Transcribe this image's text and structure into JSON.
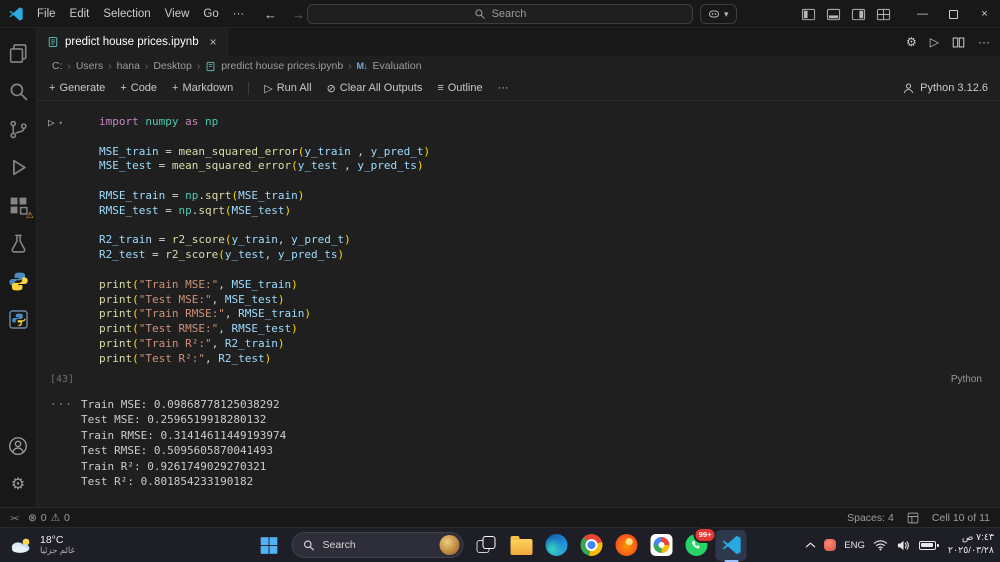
{
  "colors": {
    "accent": "#0078d4",
    "editor_bg": "#1f1f1f",
    "chrome_bg": "#181818",
    "whatsapp_green": "#25d366",
    "warning_orange": "#f0a732",
    "vscode_blue": "#2aa9e0"
  },
  "icons": {
    "plus": "+",
    "run": "▷",
    "clear": "⊘",
    "outline": "≡",
    "more": "···",
    "close": "×",
    "back": "←",
    "forward": "→",
    "chevron_down": "▾",
    "minimize": "—",
    "gear": "⚙",
    "error": "⊗",
    "warning": "⚠",
    "remote": "><",
    "output_ellipsis": "···"
  },
  "titlebar": {
    "menus": [
      "File",
      "Edit",
      "Selection",
      "View",
      "Go"
    ],
    "search_placeholder": "Search"
  },
  "tab": {
    "label": "predict house prices.ipynb"
  },
  "breadcrumb": {
    "drive": "C:",
    "users": "Users",
    "user": "hana",
    "desktop": "Desktop",
    "file": "predict house prices.ipynb",
    "section": "Evaluation",
    "sep": "›",
    "md_icon": "M↓"
  },
  "nb_toolbar": {
    "generate": "Generate",
    "code": "Code",
    "markdown": "Markdown",
    "run_all": "Run All",
    "clear_all": "Clear All Outputs",
    "outline": "Outline",
    "kernel": "Python 3.12.6"
  },
  "notebook": {
    "exec_count": "[43]",
    "language": "Python",
    "code_lines": [
      [
        {
          "t": "import ",
          "c": "kw"
        },
        {
          "t": "numpy ",
          "c": "mod"
        },
        {
          "t": "as ",
          "c": "kw"
        },
        {
          "t": "np",
          "c": "mod"
        }
      ],
      [],
      [
        {
          "t": "MSE_train ",
          "c": "var"
        },
        {
          "t": "= ",
          "c": "pl"
        },
        {
          "t": "mean_squared_error",
          "c": "fn"
        },
        {
          "t": "(",
          "c": "br"
        },
        {
          "t": "y_train",
          "c": "var"
        },
        {
          "t": " , ",
          "c": "pl"
        },
        {
          "t": "y_pred_t",
          "c": "var"
        },
        {
          "t": ")",
          "c": "br"
        }
      ],
      [
        {
          "t": "MSE_test ",
          "c": "var"
        },
        {
          "t": "= ",
          "c": "pl"
        },
        {
          "t": "mean_squared_error",
          "c": "fn"
        },
        {
          "t": "(",
          "c": "br"
        },
        {
          "t": "y_test",
          "c": "var"
        },
        {
          "t": " , ",
          "c": "pl"
        },
        {
          "t": "y_pred_ts",
          "c": "var"
        },
        {
          "t": ")",
          "c": "br"
        }
      ],
      [],
      [
        {
          "t": "RMSE_train ",
          "c": "var"
        },
        {
          "t": "= ",
          "c": "pl"
        },
        {
          "t": "np",
          "c": "mod"
        },
        {
          "t": ".",
          "c": "pl"
        },
        {
          "t": "sqrt",
          "c": "fn"
        },
        {
          "t": "(",
          "c": "br"
        },
        {
          "t": "MSE_train",
          "c": "var"
        },
        {
          "t": ")",
          "c": "br"
        }
      ],
      [
        {
          "t": "RMSE_test ",
          "c": "var"
        },
        {
          "t": "= ",
          "c": "pl"
        },
        {
          "t": "np",
          "c": "mod"
        },
        {
          "t": ".",
          "c": "pl"
        },
        {
          "t": "sqrt",
          "c": "fn"
        },
        {
          "t": "(",
          "c": "br"
        },
        {
          "t": "MSE_test",
          "c": "var"
        },
        {
          "t": ")",
          "c": "br"
        }
      ],
      [],
      [
        {
          "t": "R2_train ",
          "c": "var"
        },
        {
          "t": "= ",
          "c": "pl"
        },
        {
          "t": "r2_score",
          "c": "fn"
        },
        {
          "t": "(",
          "c": "br"
        },
        {
          "t": "y_train",
          "c": "var"
        },
        {
          "t": ", ",
          "c": "pl"
        },
        {
          "t": "y_pred_t",
          "c": "var"
        },
        {
          "t": ")",
          "c": "br"
        }
      ],
      [
        {
          "t": "R2_test ",
          "c": "var"
        },
        {
          "t": "= ",
          "c": "pl"
        },
        {
          "t": "r2_score",
          "c": "fn"
        },
        {
          "t": "(",
          "c": "br"
        },
        {
          "t": "y_test",
          "c": "var"
        },
        {
          "t": ", ",
          "c": "pl"
        },
        {
          "t": "y_pred_ts",
          "c": "var"
        },
        {
          "t": ")",
          "c": "br"
        }
      ],
      [],
      [
        {
          "t": "print",
          "c": "fn"
        },
        {
          "t": "(",
          "c": "br"
        },
        {
          "t": "\"Train MSE:\"",
          "c": "str"
        },
        {
          "t": ", ",
          "c": "pl"
        },
        {
          "t": "MSE_train",
          "c": "var"
        },
        {
          "t": ")",
          "c": "br"
        }
      ],
      [
        {
          "t": "print",
          "c": "fn"
        },
        {
          "t": "(",
          "c": "br"
        },
        {
          "t": "\"Test MSE:\"",
          "c": "str"
        },
        {
          "t": ", ",
          "c": "pl"
        },
        {
          "t": "MSE_test",
          "c": "var"
        },
        {
          "t": ")",
          "c": "br"
        }
      ],
      [
        {
          "t": "print",
          "c": "fn"
        },
        {
          "t": "(",
          "c": "br"
        },
        {
          "t": "\"Train RMSE:\"",
          "c": "str"
        },
        {
          "t": ", ",
          "c": "pl"
        },
        {
          "t": "RMSE_train",
          "c": "var"
        },
        {
          "t": ")",
          "c": "br"
        }
      ],
      [
        {
          "t": "print",
          "c": "fn"
        },
        {
          "t": "(",
          "c": "br"
        },
        {
          "t": "\"Test RMSE:\"",
          "c": "str"
        },
        {
          "t": ", ",
          "c": "pl"
        },
        {
          "t": "RMSE_test",
          "c": "var"
        },
        {
          "t": ")",
          "c": "br"
        }
      ],
      [
        {
          "t": "print",
          "c": "fn"
        },
        {
          "t": "(",
          "c": "br"
        },
        {
          "t": "\"Train R²:\"",
          "c": "str"
        },
        {
          "t": ", ",
          "c": "pl"
        },
        {
          "t": "R2_train",
          "c": "var"
        },
        {
          "t": ")",
          "c": "br"
        }
      ],
      [
        {
          "t": "print",
          "c": "fn"
        },
        {
          "t": "(",
          "c": "br"
        },
        {
          "t": "\"Test R²:\"",
          "c": "str"
        },
        {
          "t": ", ",
          "c": "pl"
        },
        {
          "t": "R2_test",
          "c": "var"
        },
        {
          "t": ")",
          "c": "br"
        }
      ]
    ],
    "output_lines": [
      "Train MSE: 0.09868778125038292",
      "Test MSE: 0.2596519918280132",
      "Train RMSE: 0.31414611449193974",
      "Test RMSE: 0.5095605870041493",
      "Train R²: 0.9261749029270321",
      "Test R²: 0.801854233190182"
    ]
  },
  "statusbar": {
    "errors": "0",
    "warnings": "0",
    "spaces": "Spaces: 4",
    "cell_indicator": "Cell 10 of 11"
  },
  "taskbar": {
    "weather": {
      "temp": "18°C",
      "desc": "غائم جزئيا"
    },
    "search_label": "Search",
    "whatsapp_badge": "99+",
    "tray": {
      "lang": "ENG",
      "time": "٧:٤٣ ص",
      "date": "٢٠٢٥/٠٣/٢٨"
    }
  }
}
